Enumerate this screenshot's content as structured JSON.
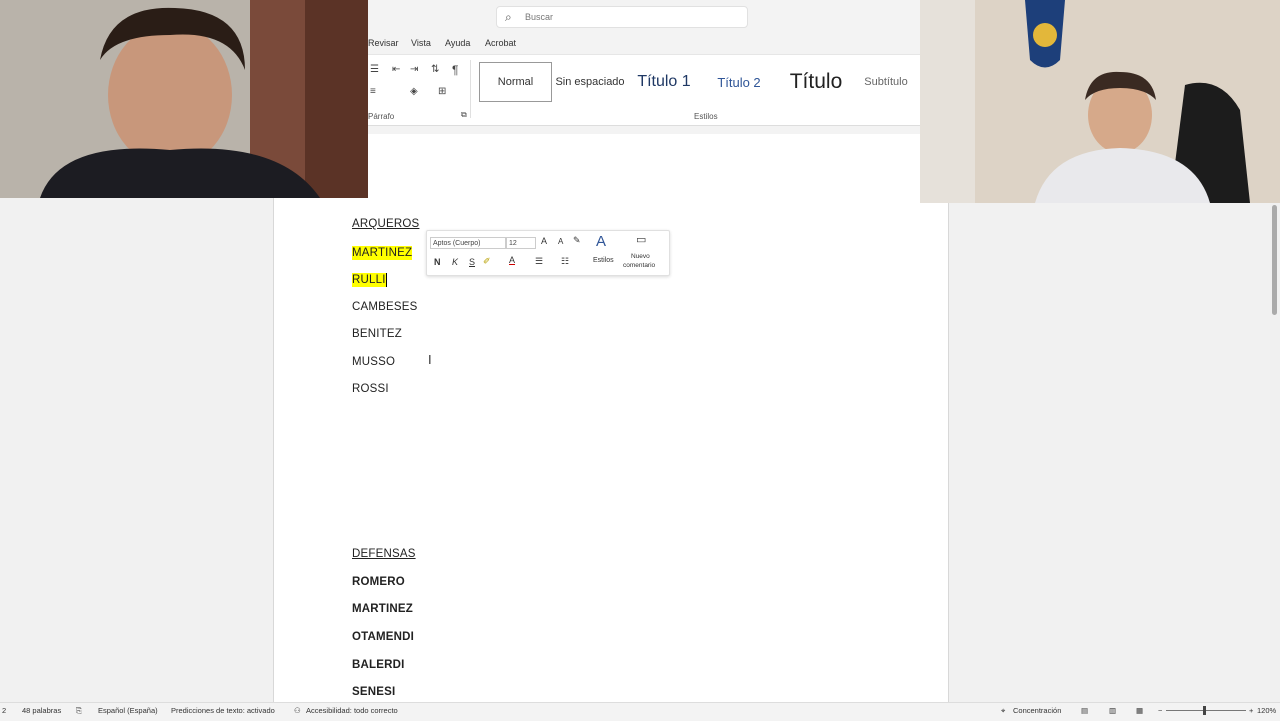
{
  "search": {
    "placeholder": "Buscar"
  },
  "menu_tabs": [
    "Revisar",
    "Vista",
    "Ayuda",
    "Acrobat"
  ],
  "ribbon": {
    "paragraph_label": "Párrafo",
    "styles_label": "Estilos",
    "styles": [
      "Normal",
      "Sin espaciado",
      "Título 1",
      "Título 2",
      "Título",
      "Subtítulo"
    ]
  },
  "mini_toolbar": {
    "font": "Aptos (Cuerpo)",
    "size": "12",
    "bold": "N",
    "italic": "K",
    "underline": "S",
    "styles": "Estilos",
    "new_comment_1": "Nuevo",
    "new_comment_2": "comentario"
  },
  "document": {
    "arqueros_heading": "ARQUEROS",
    "arqueros": [
      "MARTINEZ",
      "RULLI",
      "CAMBESES",
      "BENITEZ",
      "MUSSO",
      "ROSSI"
    ],
    "defensas_heading": "DEFENSAS",
    "defensas": [
      "ROMERO",
      "MARTINEZ",
      "OTAMENDI",
      "BALERDI",
      "SENESI"
    ]
  },
  "status": {
    "page": "2",
    "words": "48 palabras",
    "language": "Español (España)",
    "predictions": "Predicciones de texto: activado",
    "accessibility": "Accesibilidad: todo correcto",
    "focus": "Concentración",
    "zoom": "120%"
  },
  "colors": {
    "highlight": "#ffff00",
    "ribbon_bg": "#ffffff"
  },
  "icons": [
    "search-icon",
    "pilcrow-icon",
    "format-painter-icon",
    "highlight-icon",
    "font-color-icon",
    "bullets-icon",
    "numbering-icon",
    "styles-icon",
    "comment-icon",
    "text-cursor-icon",
    "accessibility-icon",
    "focus-icon",
    "read-mode-icon",
    "print-layout-icon",
    "web-layout-icon"
  ]
}
